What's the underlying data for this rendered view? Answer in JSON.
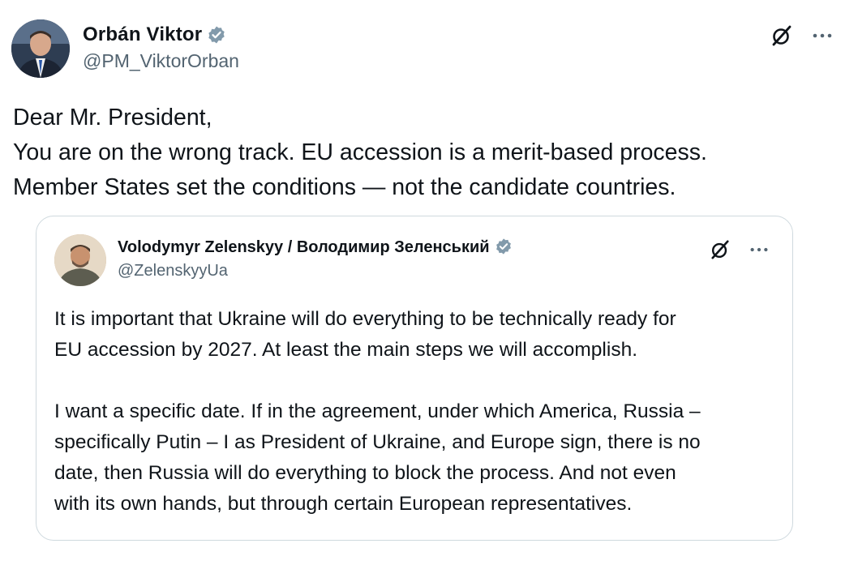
{
  "post": {
    "author_name": "Orbán Viktor",
    "author_handle": "@PM_ViktorOrban",
    "lines": [
      "Dear Mr. President,",
      "You are on the wrong track. EU accession is a merit-based process.",
      "Member States set the conditions — not the candidate countries."
    ]
  },
  "quoted": {
    "author_name": "Volodymyr Zelenskyy / Володимир Зеленський",
    "author_handle": "@ZelenskyyUa",
    "paragraph1": [
      "It is important that Ukraine will do everything to be technically ready for",
      "EU accession by 2027. At least the main steps we will accomplish."
    ],
    "paragraph2": [
      "I want a specific date. If in the agreement, under which America, Russia –",
      "specifically Putin – I as President of Ukraine, and Europe sign, there is no",
      "date, then Russia will do everything to block the process. And not even",
      "with its own hands, but through certain European representatives."
    ]
  },
  "colors": {
    "verified": "#829aab",
    "text": "#0f1419",
    "muted": "#536471",
    "border": "#cfd9de"
  },
  "icons": [
    "verified-badge-icon",
    "grok-icon",
    "more-icon"
  ]
}
